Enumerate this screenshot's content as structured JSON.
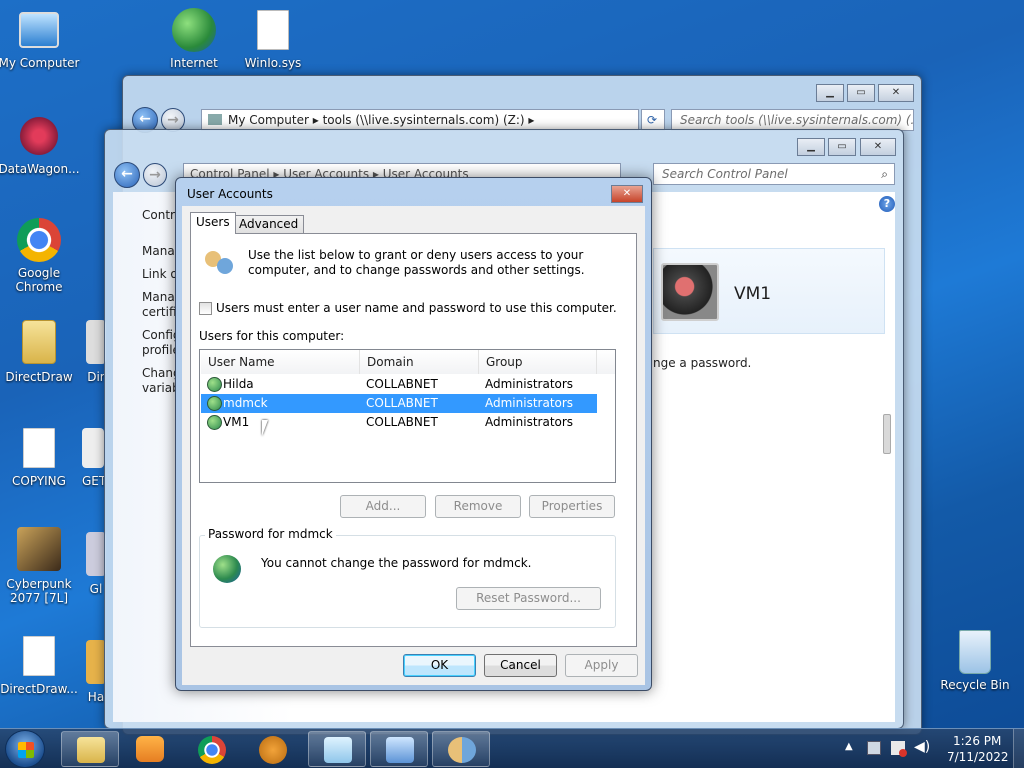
{
  "desktop": {
    "icons": [
      {
        "label": "My Computer"
      },
      {
        "label": "Internet"
      },
      {
        "label": "WinIo.sys"
      },
      {
        "label": "DataWagon..."
      },
      {
        "label": "Google Chrome"
      },
      {
        "label": "DirectDraw"
      },
      {
        "label": "Dir"
      },
      {
        "label": "COPYING"
      },
      {
        "label": "GET"
      },
      {
        "label": "Cyberpunk 2077 [7L]"
      },
      {
        "label": "Gl"
      },
      {
        "label": "DirectDraw..."
      },
      {
        "label": "Ha"
      },
      {
        "label": "Recycle Bin"
      }
    ]
  },
  "explorer_window": {
    "address": "My Computer  ▸  tools (\\\\live.sysinternals.com) (Z:)  ▸",
    "search_placeholder": "Search tools (\\\\live.sysinternals.com) (..."
  },
  "control_panel_window": {
    "address": "Control Panel  ▸  User Accounts  ▸  User Accounts",
    "search_placeholder": "Search Control Panel",
    "left_links": [
      "Contro",
      "Manag",
      "Link or",
      "Manag certifi",
      "Config profile",
      "Chang variab"
    ],
    "user_name": "VM1",
    "change_password_text": "nge a password."
  },
  "dialog": {
    "title": "User Accounts",
    "tabs": [
      "Users",
      "Advanced"
    ],
    "intro_text": "Use the list below to grant or deny users access to your computer, and to change passwords and other settings.",
    "must_enter_checkbox_label": "Users must enter a user name and password to use this computer.",
    "must_enter_checked": false,
    "users_label": "Users for this computer:",
    "columns": [
      "User Name",
      "Domain",
      "Group"
    ],
    "users": [
      {
        "name": "Hilda",
        "domain": "COLLABNET",
        "group": "Administrators"
      },
      {
        "name": "mdmck",
        "domain": "COLLABNET",
        "group": "Administrators"
      },
      {
        "name": "VM1",
        "domain": "COLLABNET",
        "group": "Administrators"
      }
    ],
    "selected_user": "mdmck",
    "add_button": "Add...",
    "remove_button": "Remove",
    "properties_button": "Properties",
    "password_group_title": "Password for mdmck",
    "password_message": "You cannot change the password for mdmck.",
    "reset_password_button": "Reset Password...",
    "ok_button": "OK",
    "cancel_button": "Cancel",
    "apply_button": "Apply"
  },
  "taskbar": {
    "time": "1:26 PM",
    "date": "7/11/2022"
  }
}
